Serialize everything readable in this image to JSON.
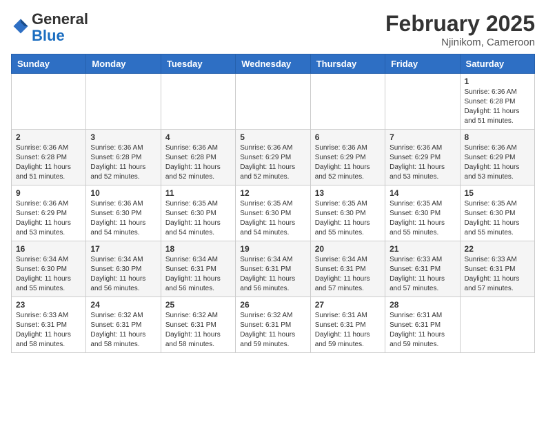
{
  "header": {
    "logo_general": "General",
    "logo_blue": "Blue",
    "month_year": "February 2025",
    "location": "Njinikom, Cameroon"
  },
  "weekdays": [
    "Sunday",
    "Monday",
    "Tuesday",
    "Wednesday",
    "Thursday",
    "Friday",
    "Saturday"
  ],
  "weeks": [
    [
      {
        "day": "",
        "info": ""
      },
      {
        "day": "",
        "info": ""
      },
      {
        "day": "",
        "info": ""
      },
      {
        "day": "",
        "info": ""
      },
      {
        "day": "",
        "info": ""
      },
      {
        "day": "",
        "info": ""
      },
      {
        "day": "1",
        "info": "Sunrise: 6:36 AM\nSunset: 6:28 PM\nDaylight: 11 hours\nand 51 minutes."
      }
    ],
    [
      {
        "day": "2",
        "info": "Sunrise: 6:36 AM\nSunset: 6:28 PM\nDaylight: 11 hours\nand 51 minutes."
      },
      {
        "day": "3",
        "info": "Sunrise: 6:36 AM\nSunset: 6:28 PM\nDaylight: 11 hours\nand 52 minutes."
      },
      {
        "day": "4",
        "info": "Sunrise: 6:36 AM\nSunset: 6:28 PM\nDaylight: 11 hours\nand 52 minutes."
      },
      {
        "day": "5",
        "info": "Sunrise: 6:36 AM\nSunset: 6:29 PM\nDaylight: 11 hours\nand 52 minutes."
      },
      {
        "day": "6",
        "info": "Sunrise: 6:36 AM\nSunset: 6:29 PM\nDaylight: 11 hours\nand 52 minutes."
      },
      {
        "day": "7",
        "info": "Sunrise: 6:36 AM\nSunset: 6:29 PM\nDaylight: 11 hours\nand 53 minutes."
      },
      {
        "day": "8",
        "info": "Sunrise: 6:36 AM\nSunset: 6:29 PM\nDaylight: 11 hours\nand 53 minutes."
      }
    ],
    [
      {
        "day": "9",
        "info": "Sunrise: 6:36 AM\nSunset: 6:29 PM\nDaylight: 11 hours\nand 53 minutes."
      },
      {
        "day": "10",
        "info": "Sunrise: 6:36 AM\nSunset: 6:30 PM\nDaylight: 11 hours\nand 54 minutes."
      },
      {
        "day": "11",
        "info": "Sunrise: 6:35 AM\nSunset: 6:30 PM\nDaylight: 11 hours\nand 54 minutes."
      },
      {
        "day": "12",
        "info": "Sunrise: 6:35 AM\nSunset: 6:30 PM\nDaylight: 11 hours\nand 54 minutes."
      },
      {
        "day": "13",
        "info": "Sunrise: 6:35 AM\nSunset: 6:30 PM\nDaylight: 11 hours\nand 55 minutes."
      },
      {
        "day": "14",
        "info": "Sunrise: 6:35 AM\nSunset: 6:30 PM\nDaylight: 11 hours\nand 55 minutes."
      },
      {
        "day": "15",
        "info": "Sunrise: 6:35 AM\nSunset: 6:30 PM\nDaylight: 11 hours\nand 55 minutes."
      }
    ],
    [
      {
        "day": "16",
        "info": "Sunrise: 6:34 AM\nSunset: 6:30 PM\nDaylight: 11 hours\nand 55 minutes."
      },
      {
        "day": "17",
        "info": "Sunrise: 6:34 AM\nSunset: 6:30 PM\nDaylight: 11 hours\nand 56 minutes."
      },
      {
        "day": "18",
        "info": "Sunrise: 6:34 AM\nSunset: 6:31 PM\nDaylight: 11 hours\nand 56 minutes."
      },
      {
        "day": "19",
        "info": "Sunrise: 6:34 AM\nSunset: 6:31 PM\nDaylight: 11 hours\nand 56 minutes."
      },
      {
        "day": "20",
        "info": "Sunrise: 6:34 AM\nSunset: 6:31 PM\nDaylight: 11 hours\nand 57 minutes."
      },
      {
        "day": "21",
        "info": "Sunrise: 6:33 AM\nSunset: 6:31 PM\nDaylight: 11 hours\nand 57 minutes."
      },
      {
        "day": "22",
        "info": "Sunrise: 6:33 AM\nSunset: 6:31 PM\nDaylight: 11 hours\nand 57 minutes."
      }
    ],
    [
      {
        "day": "23",
        "info": "Sunrise: 6:33 AM\nSunset: 6:31 PM\nDaylight: 11 hours\nand 58 minutes."
      },
      {
        "day": "24",
        "info": "Sunrise: 6:32 AM\nSunset: 6:31 PM\nDaylight: 11 hours\nand 58 minutes."
      },
      {
        "day": "25",
        "info": "Sunrise: 6:32 AM\nSunset: 6:31 PM\nDaylight: 11 hours\nand 58 minutes."
      },
      {
        "day": "26",
        "info": "Sunrise: 6:32 AM\nSunset: 6:31 PM\nDaylight: 11 hours\nand 59 minutes."
      },
      {
        "day": "27",
        "info": "Sunrise: 6:31 AM\nSunset: 6:31 PM\nDaylight: 11 hours\nand 59 minutes."
      },
      {
        "day": "28",
        "info": "Sunrise: 6:31 AM\nSunset: 6:31 PM\nDaylight: 11 hours\nand 59 minutes."
      },
      {
        "day": "",
        "info": ""
      }
    ]
  ]
}
